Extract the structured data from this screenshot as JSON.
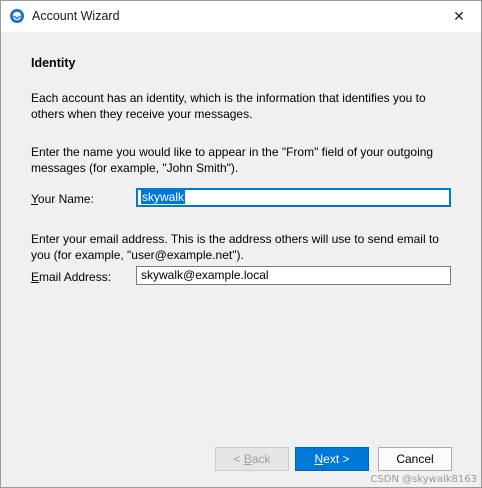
{
  "window": {
    "title": "Account Wizard",
    "close_glyph": "✕"
  },
  "page": {
    "title": "Identity",
    "intro": "Each account has an identity, which is the information that identifies you to others when they receive your messages.",
    "name_instructions": "Enter the name you would like to appear in the \"From\" field of your outgoing messages (for example, \"John Smith\").",
    "email_instructions": "Enter your email address. This is the address others will use to send email to you (for example, \"user@example.net\")."
  },
  "form": {
    "name_label_mnemonic": "Y",
    "name_label_rest": "our Name:",
    "name_value": "skywalk",
    "email_label_mnemonic": "E",
    "email_label_rest": "mail Address:",
    "email_value": "skywalk@example.local"
  },
  "buttons": {
    "back_prefix": "< ",
    "back_mnemonic": "B",
    "back_rest": "ack",
    "next_mnemonic": "N",
    "next_rest": "ext >",
    "cancel_label": "Cancel"
  },
  "watermark": "CSDN @skywalk8163",
  "colors": {
    "accent": "#0078d7",
    "dialog_background": "#f0f0f0"
  }
}
